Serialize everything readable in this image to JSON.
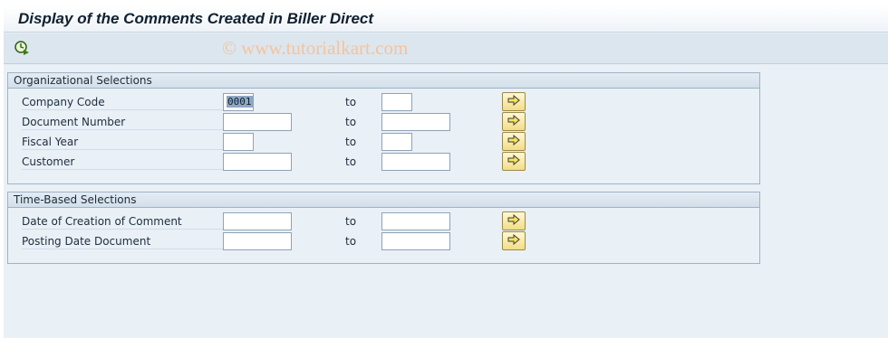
{
  "title": "Display of the Comments Created in Biller Direct",
  "toolbar": {
    "execute_icon": "execute-icon"
  },
  "watermark": "© www.tutorialkart.com",
  "org_group": {
    "header": "Organizational Selections",
    "rows": [
      {
        "label": "Company Code",
        "low": "0001",
        "to": "to",
        "high": ""
      },
      {
        "label": "Document Number",
        "low": "",
        "to": "to",
        "high": ""
      },
      {
        "label": "Fiscal Year",
        "low": "",
        "to": "to",
        "high": ""
      },
      {
        "label": "Customer",
        "low": "",
        "to": "to",
        "high": ""
      }
    ]
  },
  "time_group": {
    "header": "Time-Based Selections",
    "rows": [
      {
        "label": "Date of Creation of Comment",
        "low": "",
        "to": "to",
        "high": ""
      },
      {
        "label": "Posting Date Document",
        "low": "",
        "to": "to",
        "high": ""
      }
    ]
  },
  "icons": {
    "multiple_selection": "arrow-right-icon"
  }
}
